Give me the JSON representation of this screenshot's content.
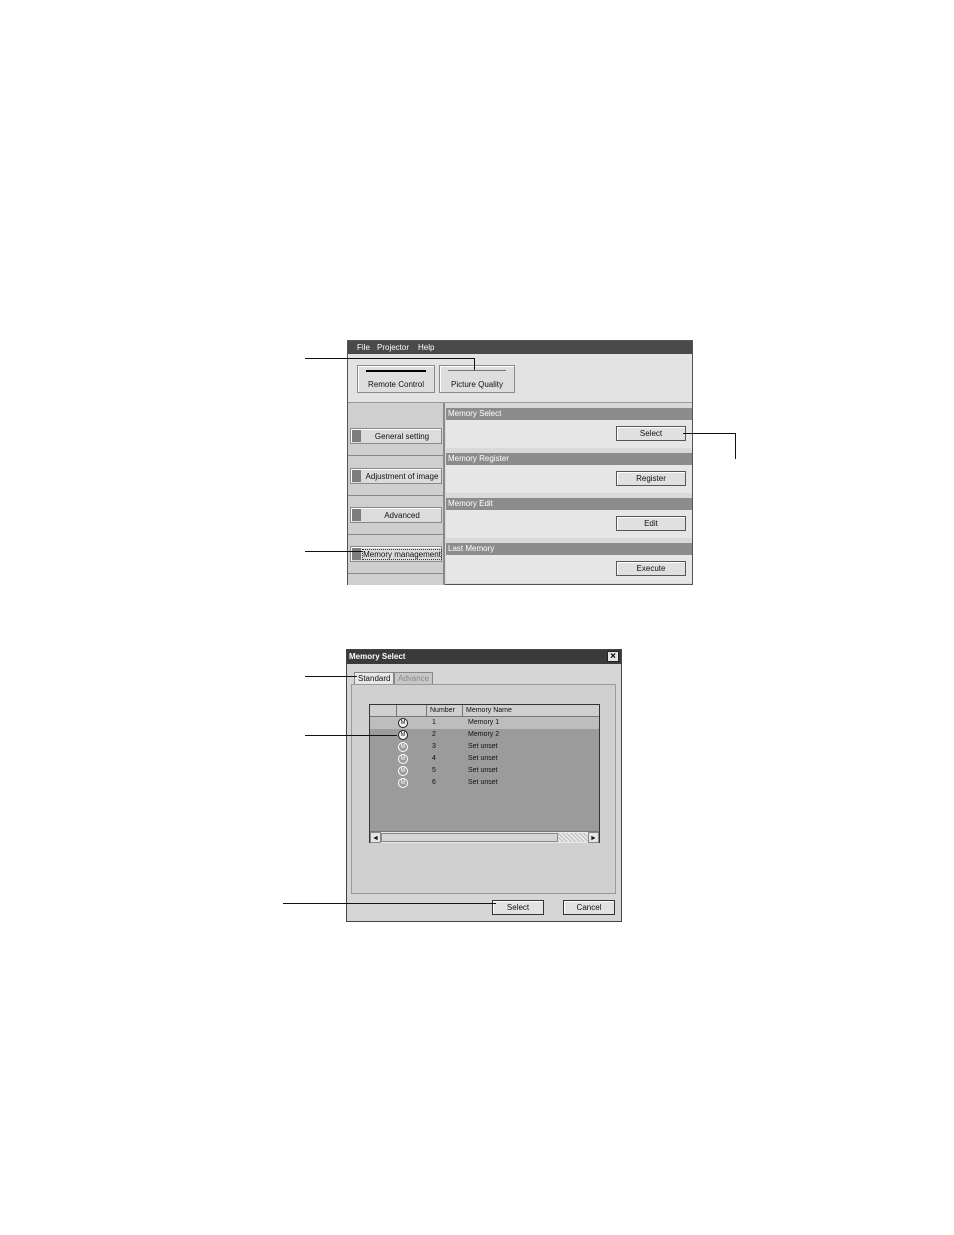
{
  "main_window": {
    "menu": [
      "File",
      "Projector",
      "Help"
    ],
    "toolbar": {
      "remote_control": "Remote Control",
      "picture_quality": "Picture Quality"
    },
    "sidebar": [
      {
        "label": "General setting"
      },
      {
        "label": "Adjustment of image"
      },
      {
        "label": "Advanced"
      },
      {
        "label": "Memory management",
        "selected": true
      }
    ],
    "sections": [
      {
        "title": "Memory Select",
        "button": "Select"
      },
      {
        "title": "Memory Register",
        "button": "Register"
      },
      {
        "title": "Memory Edit",
        "button": "Edit"
      },
      {
        "title": "Last Memory",
        "button": "Execute"
      }
    ]
  },
  "dialog": {
    "title": "Memory Select",
    "close_glyph": "×",
    "tabs": [
      {
        "label": "Standard",
        "active": true
      },
      {
        "label": "Advance",
        "active": false
      }
    ],
    "list": {
      "columns": [
        "",
        "",
        "Number",
        "Memory Name"
      ],
      "icon_glyph": "M",
      "rows": [
        {
          "number": "1",
          "name": "Memory 1",
          "icon": "memory-set-icon"
        },
        {
          "number": "2",
          "name": "Memory 2",
          "icon": "memory-set-icon"
        },
        {
          "number": "3",
          "name": "Set unset",
          "icon": "memory-unset-icon"
        },
        {
          "number": "4",
          "name": "Set unset",
          "icon": "memory-unset-icon"
        },
        {
          "number": "5",
          "name": "Set unset",
          "icon": "memory-unset-icon"
        },
        {
          "number": "6",
          "name": "Set unset",
          "icon": "memory-unset-icon"
        }
      ]
    },
    "scroll_left": "◄",
    "scroll_right": "►",
    "select_button": "Select",
    "cancel_button": "Cancel"
  }
}
